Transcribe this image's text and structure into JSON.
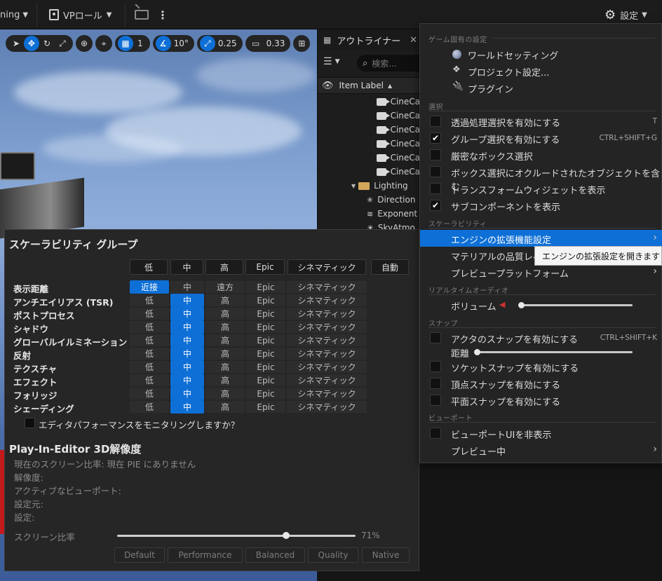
{
  "topbar": {
    "left_menu": "ning",
    "role_menu": "VPロール",
    "settings": "設定"
  },
  "viewport_toolbar": {
    "grid_value": "1",
    "angle_value": "10°",
    "scale_value": "0.25",
    "camera_value": "0.33"
  },
  "outliner": {
    "title": "アウトライナー",
    "search_placeholder": "検索...",
    "column_label": "Item Label",
    "rows": [
      "CineCa",
      "CineCa",
      "CineCa",
      "CineCa",
      "CineCa",
      "CineCa",
      "Lighting",
      "Direction",
      "Exponent",
      "SkyAtmo"
    ]
  },
  "scalability": {
    "title": "スケーラビリティ グループ",
    "headers": [
      "低",
      "中",
      "高",
      "Epic",
      "シネマティック",
      "自動"
    ],
    "groups": [
      {
        "label": "表示距離",
        "values": [
          "近接",
          "中",
          "遠方",
          "Epic",
          "シネマティック"
        ],
        "selected": 0
      },
      {
        "label": "アンチエイリアス (TSR)",
        "values": [
          "低",
          "中",
          "高",
          "Epic",
          "シネマティック"
        ],
        "selected": 1
      },
      {
        "label": "ポストプロセス",
        "values": [
          "低",
          "中",
          "高",
          "Epic",
          "シネマティック"
        ],
        "selected": 1
      },
      {
        "label": "シャドウ",
        "values": [
          "低",
          "中",
          "高",
          "Epic",
          "シネマティック"
        ],
        "selected": 1
      },
      {
        "label": "グローバルイルミネーション",
        "values": [
          "低",
          "中",
          "高",
          "Epic",
          "シネマティック"
        ],
        "selected": 1
      },
      {
        "label": "反射",
        "values": [
          "低",
          "中",
          "高",
          "Epic",
          "シネマティック"
        ],
        "selected": 1
      },
      {
        "label": "テクスチャ",
        "values": [
          "低",
          "中",
          "高",
          "Epic",
          "シネマティック"
        ],
        "selected": 1
      },
      {
        "label": "エフェクト",
        "values": [
          "低",
          "中",
          "高",
          "Epic",
          "シネマティック"
        ],
        "selected": 1
      },
      {
        "label": "フォリッジ",
        "values": [
          "低",
          "中",
          "高",
          "Epic",
          "シネマティック"
        ],
        "selected": 1
      },
      {
        "label": "シェーディング",
        "values": [
          "低",
          "中",
          "高",
          "Epic",
          "シネマティック"
        ],
        "selected": 1
      }
    ],
    "monitor_label": "エディタパフォーマンスをモニタリングしますか？",
    "pie_title": "Play-In-Editor 3D解像度",
    "info_lines": [
      "現在のスクリーン比率: 現在 PIE にありません",
      "解像度:",
      "アクティブなビューポート:",
      "設定元:",
      "設定:"
    ],
    "screen_ratio_label": "スクリーン比率",
    "screen_ratio_value": "71%",
    "screen_ratio_fraction": 0.71,
    "presets": [
      "Default",
      "Performance",
      "Balanced",
      "Quality",
      "Native"
    ]
  },
  "menu": {
    "sections": {
      "game": "ゲーム固有の設定",
      "select": "選択",
      "scal": "スケーラビリティ",
      "audio": "リアルタイムオーディオ",
      "snap": "スナップ",
      "viewport": "ビューポート"
    },
    "game_items": [
      "ワールドセッティング",
      "プロジェクト設定...",
      "プラグイン"
    ],
    "select_items": [
      {
        "label": "透過処理選択を有効にする",
        "checked": false,
        "shortcut": "T"
      },
      {
        "label": "グループ選択を有効にする",
        "checked": true,
        "shortcut": "CTRL+SHIFT+G"
      },
      {
        "label": "厳密なボックス選択",
        "checked": false,
        "shortcut": ""
      },
      {
        "label": "ボックス選択にオクルードされたオブジェクトを含む",
        "checked": false,
        "shortcut": ""
      },
      {
        "label": "トランスフォームウィジェットを表示",
        "checked": false,
        "shortcut": ""
      },
      {
        "label": "サブコンポーネントを表示",
        "checked": true,
        "shortcut": ""
      }
    ],
    "scal_items": [
      "エンジンの拡張機能設定",
      "マテリアルの品質レベ",
      "プレビュープラットフォーム"
    ],
    "volume_label": "ボリューム",
    "snap_actor": {
      "label": "アクタのスナップを有効にする",
      "shortcut": "CTRL+SHIFT+K"
    },
    "distance_label": "距離",
    "snap_items": [
      "ソケットスナップを有効にする",
      "頂点スナップを有効にする",
      "平面スナップを有効にする"
    ],
    "hide_ui": "ビューポートUIを非表示",
    "preview": "プレビュー中"
  },
  "tooltip": "エンジンの拡張設定を開きます",
  "colors": {
    "accent": "#0e6fd6",
    "panel": "#262626",
    "menu": "#242424"
  }
}
